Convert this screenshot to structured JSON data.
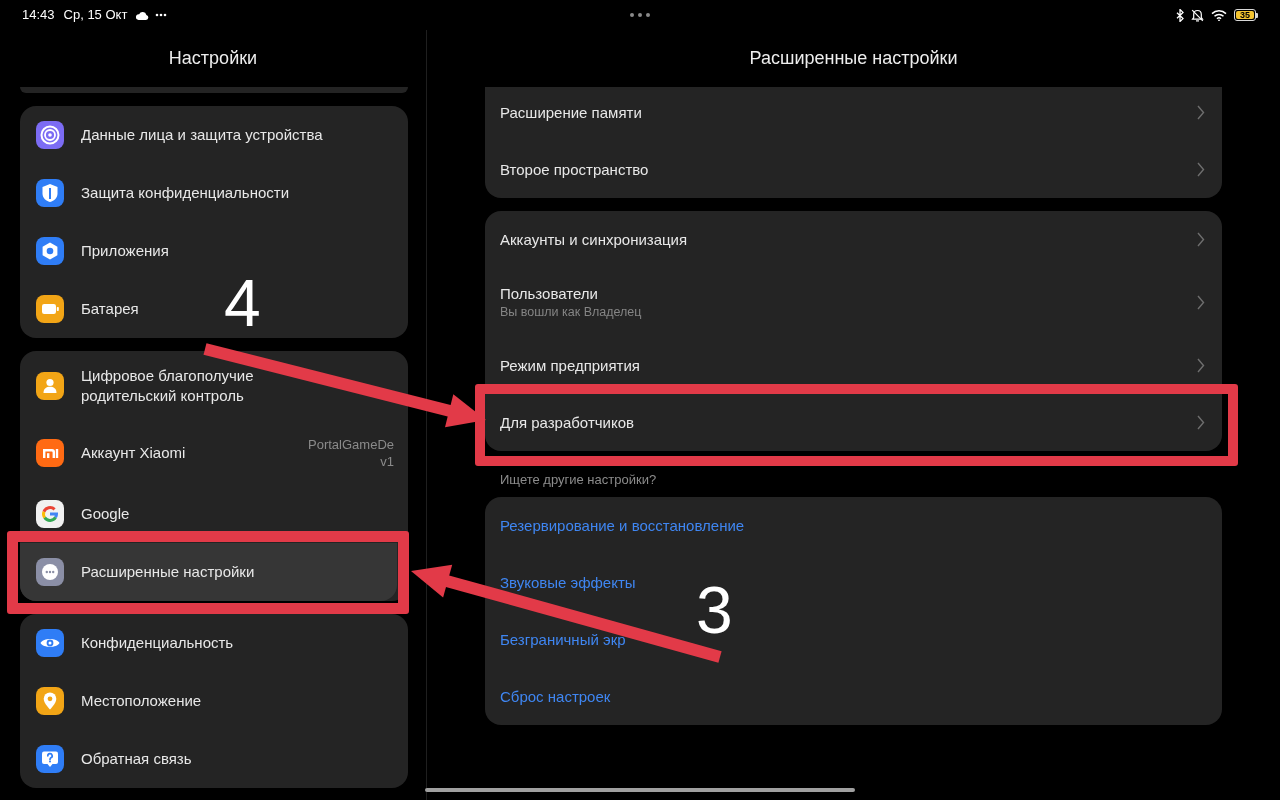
{
  "status_bar": {
    "time": "14:43",
    "date": "Ср, 15 Окт",
    "battery": "35"
  },
  "left_pane": {
    "title": "Настройки",
    "groups": [
      {
        "items": [
          {
            "title": "Данные лица и защита устройства",
            "color": "#7c6cf4",
            "selected": false,
            "callout": false
          },
          {
            "title": "Защита конфиденциальности",
            "color": "#2f7df6",
            "selected": false,
            "callout": false
          },
          {
            "title": "Приложения",
            "color": "#2f7df6",
            "selected": false,
            "callout": false
          },
          {
            "title": "Батарея",
            "color": "#f2a516",
            "selected": false,
            "callout": false
          }
        ]
      },
      {
        "items": [
          {
            "title": "Цифровое благополучие\nродительский контроль",
            "color": "#f2a516",
            "selected": false,
            "callout": false
          },
          {
            "title": "Аккаунт Xiaomi",
            "value": "PortalGameDe\nv1",
            "color": "#ff6a13",
            "selected": false,
            "callout": false
          },
          {
            "title": "Google",
            "color": "#f1f1f1",
            "selected": false,
            "callout": false
          },
          {
            "title": "Расширенные настройки",
            "color": "#8b8fa6",
            "selected": true,
            "callout": true
          }
        ]
      },
      {
        "items": [
          {
            "title": "Конфиденциальность",
            "color": "#2f7df6",
            "selected": false,
            "callout": false
          },
          {
            "title": "Местоположение",
            "color": "#f2a516",
            "selected": false,
            "callout": false
          },
          {
            "title": "Обратная связь",
            "color": "#2f7df6",
            "selected": false,
            "callout": false
          }
        ]
      }
    ]
  },
  "right_pane": {
    "title": "Расширенные настройки",
    "groups": [
      {
        "items": [
          {
            "title": "Расширение памяти",
            "callout": false
          },
          {
            "title": "Второе пространство",
            "callout": false
          }
        ]
      },
      {
        "items": [
          {
            "title": "Аккаунты и синхронизация",
            "callout": false
          },
          {
            "title": "Пользователи",
            "subtitle": "Вы вошли как Владелец",
            "callout": false
          },
          {
            "title": "Режим предприятия",
            "callout": false
          },
          {
            "title": "Для разработчиков",
            "callout": true
          }
        ]
      }
    ],
    "suggestions": {
      "label": "Ищете другие настройки?",
      "items": [
        "Резервирование и восстановление",
        "Звуковые эффекты",
        "Безграничный экр",
        "Сброс настроек"
      ]
    }
  },
  "annotations": [
    {
      "number": "4"
    },
    {
      "number": "3"
    }
  ]
}
